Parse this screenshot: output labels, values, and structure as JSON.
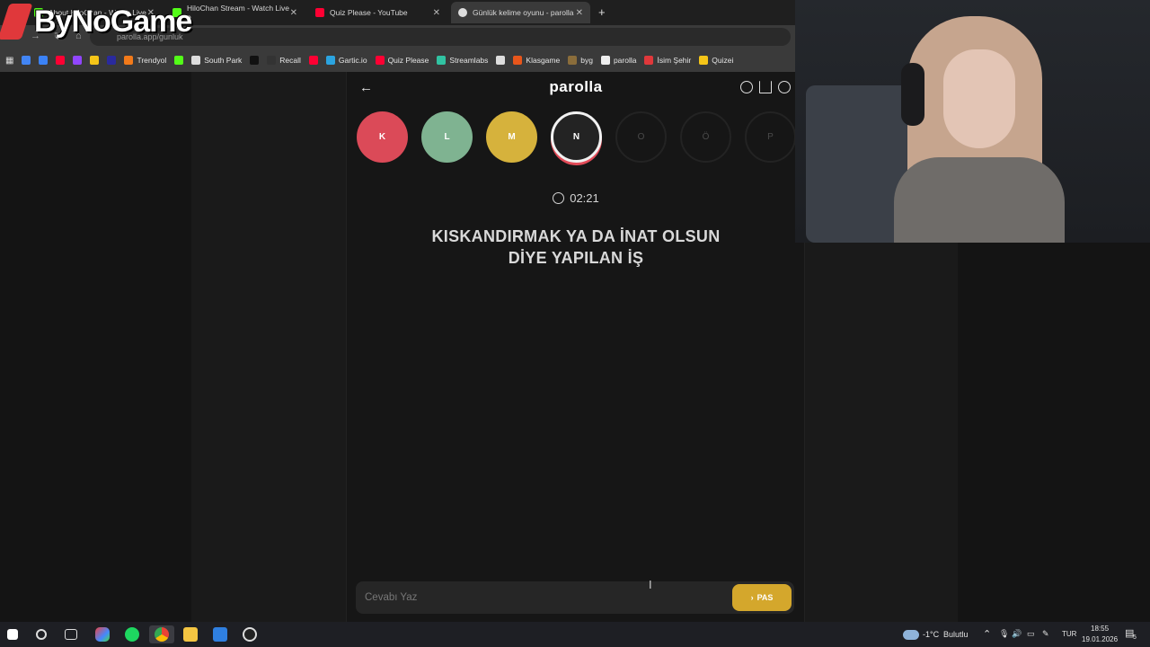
{
  "browser": {
    "tabs": [
      {
        "title": "About HiloChan - Watch Live",
        "color": "#53fc18"
      },
      {
        "title": "HiloChan Stream - Watch Live o",
        "color": "#53fc18"
      },
      {
        "title": "Quiz Please - YouTube",
        "color": "#ff0033"
      },
      {
        "title": "Günlük kelime oyunu - parolla",
        "color": "#dddddd"
      }
    ],
    "url": "parolla.app/gunluk",
    "bookmarks": [
      {
        "label": "",
        "color": "#4285f4"
      },
      {
        "label": "",
        "color": "#3b82f6"
      },
      {
        "label": "",
        "color": "#ff0033"
      },
      {
        "label": "",
        "color": "#9146ff"
      },
      {
        "label": "",
        "color": "#f5c518"
      },
      {
        "label": "",
        "color": "#2a2a9e"
      },
      {
        "label": "Trendyol",
        "color": "#f27a1a"
      },
      {
        "label": "",
        "color": "#53fc18"
      },
      {
        "label": "South Park",
        "color": "#dddddd"
      },
      {
        "label": "",
        "color": "#111111"
      },
      {
        "label": "Recall",
        "color": "#333333"
      },
      {
        "label": "",
        "color": "#ff0033"
      },
      {
        "label": "Gartic.io",
        "color": "#2ba4e0"
      },
      {
        "label": "Quiz Please",
        "color": "#ff0033"
      },
      {
        "label": "Streamlabs",
        "color": "#31c3a2"
      },
      {
        "label": "",
        "color": "#dddddd"
      },
      {
        "label": "Klasgame",
        "color": "#e8561b"
      },
      {
        "label": "byg",
        "color": "#8a6d3b"
      },
      {
        "label": "parolla",
        "color": "#eeeeee"
      },
      {
        "label": "İsim Şehir",
        "color": "#e0383b"
      },
      {
        "label": "Quizei",
        "color": "#f5c518"
      }
    ]
  },
  "watermark": {
    "text": "ByNoGame"
  },
  "app": {
    "brand": "parolla",
    "letters": [
      {
        "char": "K",
        "state": "wrong",
        "color": "#db4a58"
      },
      {
        "char": "L",
        "state": "correct",
        "color": "#7fb391"
      },
      {
        "char": "M",
        "state": "pass",
        "color": "#d6b23c"
      },
      {
        "char": "N",
        "state": "current",
        "color": "#232323"
      },
      {
        "char": "O",
        "state": "future",
        "color": ""
      },
      {
        "char": "Ö",
        "state": "future",
        "color": ""
      },
      {
        "char": "P",
        "state": "future",
        "color": ""
      }
    ],
    "timer": "02:21",
    "question_line1": "KISKANDIRMAK YA DA İNAT OLSUN",
    "question_line2": "DİYE YAPILAN İŞ",
    "answer_placeholder": "Cevabı Yaz",
    "pass_label": "PAS"
  },
  "taskbar": {
    "weather_temp": "-1°C",
    "weather_desc": "Bulutlu",
    "language": "TUR",
    "time": "18:55",
    "date": "19.01.2026",
    "notification_count": "5"
  }
}
